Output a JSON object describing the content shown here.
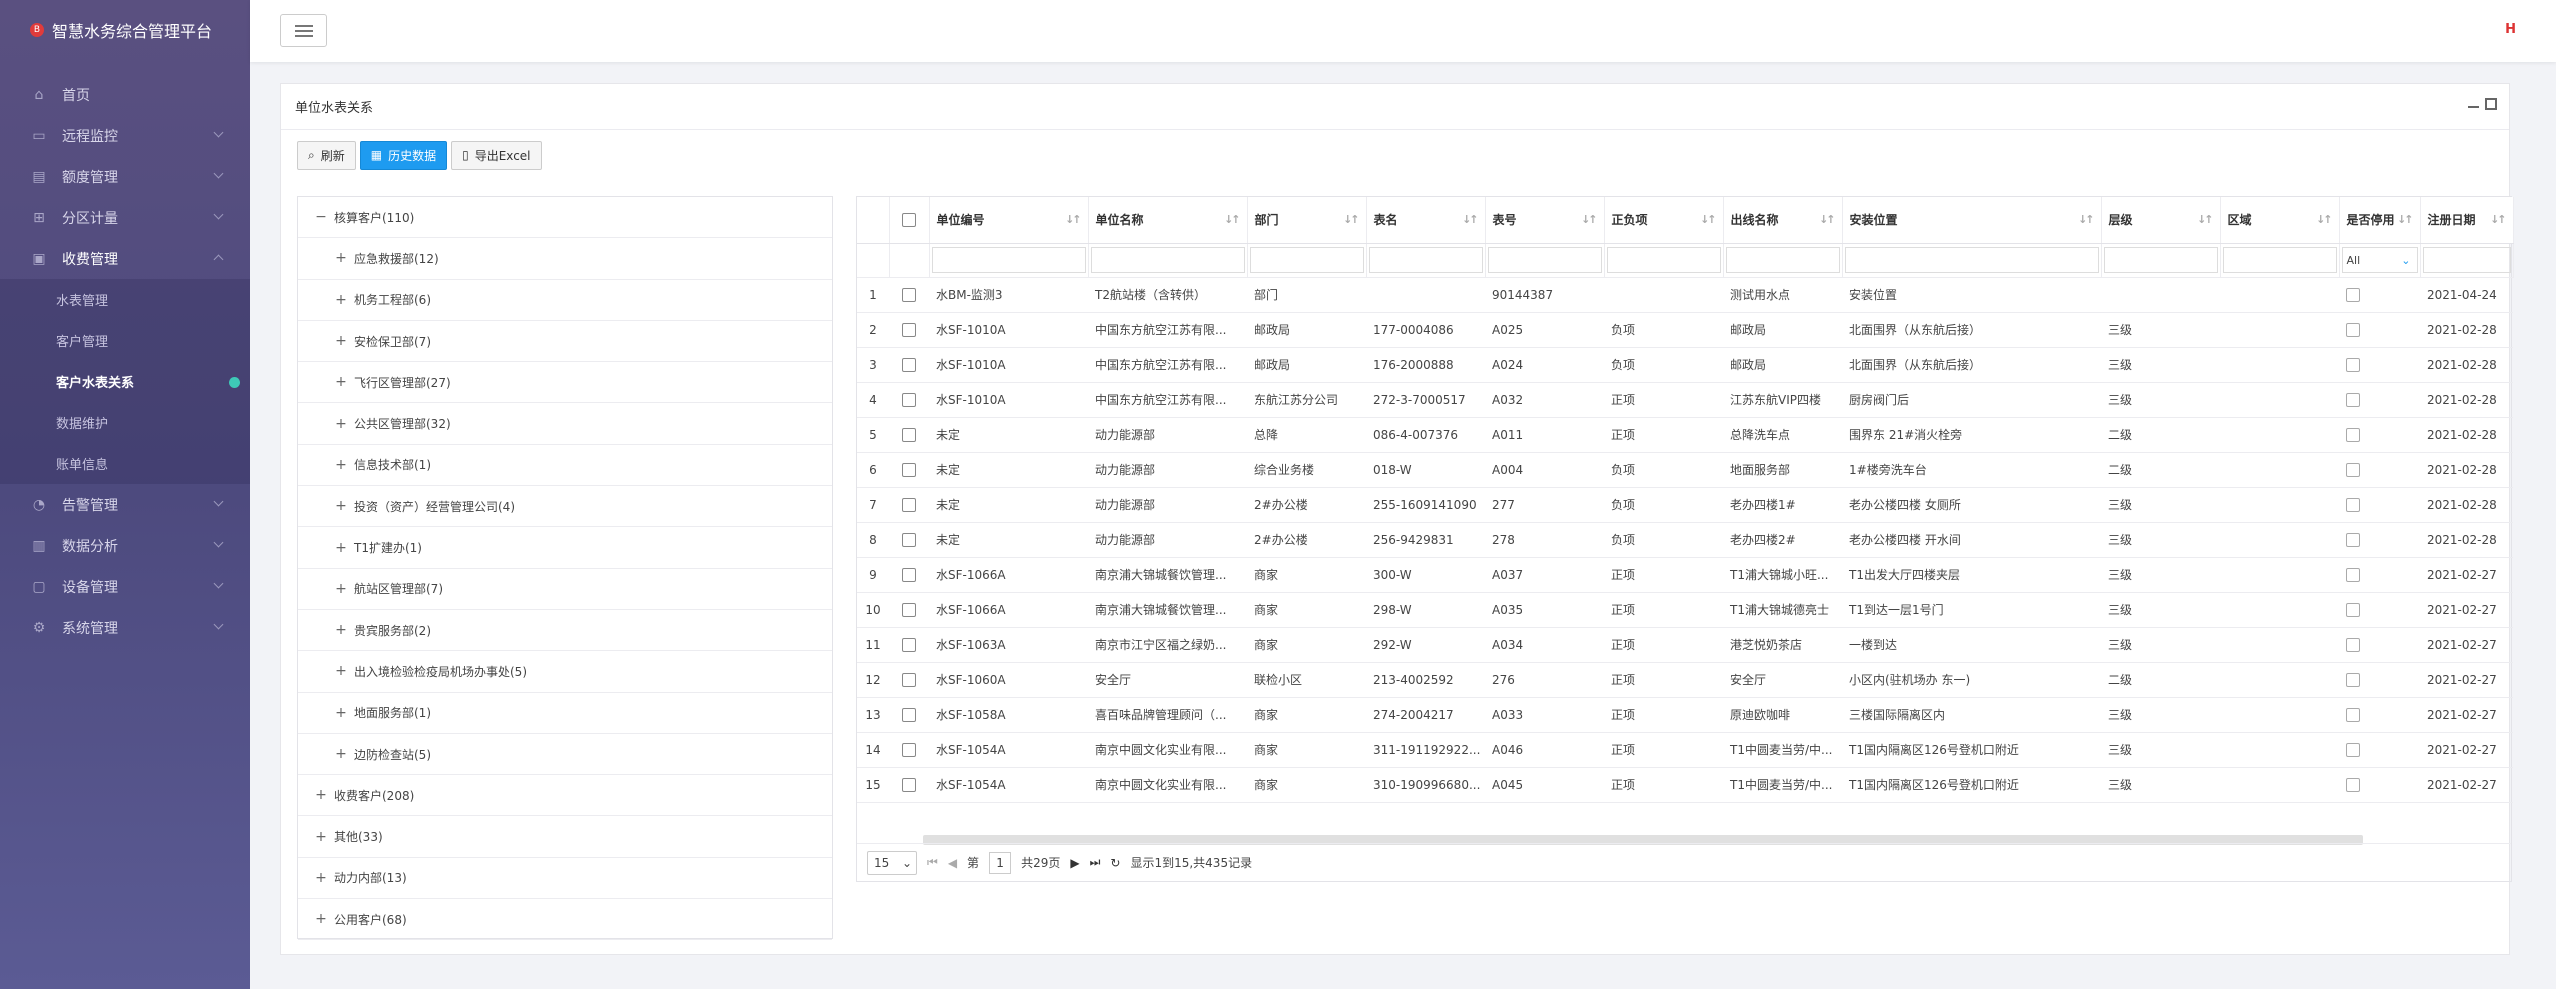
{
  "app": {
    "title": "智慧水务综合管理平台"
  },
  "sidebar": {
    "items": [
      {
        "label": "首页",
        "icon": "home-icon"
      },
      {
        "label": "远程监控",
        "icon": "monitor-icon"
      },
      {
        "label": "额度管理",
        "icon": "quota-icon"
      },
      {
        "label": "分区计量",
        "icon": "partition-icon"
      },
      {
        "label": "收费管理",
        "icon": "billing-icon"
      },
      {
        "label": "告警管理",
        "icon": "alarm-icon"
      },
      {
        "label": "数据分析",
        "icon": "analysis-icon"
      },
      {
        "label": "设备管理",
        "icon": "device-icon"
      },
      {
        "label": "系统管理",
        "icon": "settings-icon"
      }
    ],
    "sub_items": [
      "水表管理",
      "客户管理",
      "客户水表关系",
      "数据维护",
      "账单信息"
    ]
  },
  "panel": {
    "title": "单位水表关系"
  },
  "toolbar": {
    "refresh": "刷新",
    "history": "历史数据",
    "export": "导出Excel"
  },
  "tree": [
    {
      "label": "核算客户(110)",
      "sign": "−",
      "level": 0
    },
    {
      "label": "应急救援部(12)",
      "sign": "+",
      "level": 1
    },
    {
      "label": "机务工程部(6)",
      "sign": "+",
      "level": 1
    },
    {
      "label": "安检保卫部(7)",
      "sign": "+",
      "level": 1
    },
    {
      "label": "飞行区管理部(27)",
      "sign": "+",
      "level": 1
    },
    {
      "label": "公共区管理部(32)",
      "sign": "+",
      "level": 1
    },
    {
      "label": "信息技术部(1)",
      "sign": "+",
      "level": 1
    },
    {
      "label": "投资（资产）经营管理公司(4)",
      "sign": "+",
      "level": 1
    },
    {
      "label": "T1扩建办(1)",
      "sign": "+",
      "level": 1
    },
    {
      "label": "航站区管理部(7)",
      "sign": "+",
      "level": 1
    },
    {
      "label": "贵宾服务部(2)",
      "sign": "+",
      "level": 1
    },
    {
      "label": "出入境检验检疫局机场办事处(5)",
      "sign": "+",
      "level": 1
    },
    {
      "label": "地面服务部(1)",
      "sign": "+",
      "level": 1
    },
    {
      "label": "边防检查站(5)",
      "sign": "+",
      "level": 1
    },
    {
      "label": "收费客户(208)",
      "sign": "+",
      "level": 0
    },
    {
      "label": "其他(33)",
      "sign": "+",
      "level": 0
    },
    {
      "label": "动力内部(13)",
      "sign": "+",
      "level": 0
    },
    {
      "label": "公用客户(68)",
      "sign": "+",
      "level": 0
    }
  ],
  "grid": {
    "columns": [
      "单位编号",
      "单位名称",
      "部门",
      "表名",
      "表号",
      "正负项",
      "出线名称",
      "安装位置",
      "层级",
      "区域",
      "是否停用",
      "注册日期"
    ],
    "filter_placeholder_install": "安装位置",
    "filter_status": "All",
    "rows": [
      [
        "1",
        "水BM-监测3",
        "T2航站楼（含转供）",
        "部门",
        "",
        "90144387",
        "",
        "测试用水点",
        "安装位置",
        "",
        "",
        "2021-04-24"
      ],
      [
        "2",
        "水SF-1010A",
        "中国东方航空江苏有限...",
        "邮政局",
        "177-0004086",
        "A025",
        "负项",
        "邮政局",
        "北面围界（从东航后接）",
        "三级",
        "",
        "2021-02-28"
      ],
      [
        "3",
        "水SF-1010A",
        "中国东方航空江苏有限...",
        "邮政局",
        "176-2000888",
        "A024",
        "负项",
        "邮政局",
        "北面围界（从东航后接）",
        "三级",
        "",
        "2021-02-28"
      ],
      [
        "4",
        "水SF-1010A",
        "中国东方航空江苏有限...",
        "东航江苏分公司",
        "272-3-7000517",
        "A032",
        "正项",
        "江苏东航VIP四楼",
        "厨房阀门后",
        "三级",
        "",
        "2021-02-28"
      ],
      [
        "5",
        "未定",
        "动力能源部",
        "总降",
        "086-4-007376",
        "A011",
        "正项",
        "总降洗车点",
        "围界东 21#消火栓旁",
        "二级",
        "",
        "2021-02-28"
      ],
      [
        "6",
        "未定",
        "动力能源部",
        "综合业务楼",
        "018-W",
        "A004",
        "负项",
        "地面服务部",
        "1#楼旁洗车台",
        "二级",
        "",
        "2021-02-28"
      ],
      [
        "7",
        "未定",
        "动力能源部",
        "2#办公楼",
        "255-1609141090",
        "277",
        "负项",
        "老办四楼1#",
        "老办公楼四楼 女厕所",
        "三级",
        "",
        "2021-02-28"
      ],
      [
        "8",
        "未定",
        "动力能源部",
        "2#办公楼",
        "256-9429831",
        "278",
        "负项",
        "老办四楼2#",
        "老办公楼四楼 开水间",
        "三级",
        "",
        "2021-02-28"
      ],
      [
        "9",
        "水SF-1066A",
        "南京浦大锦城餐饮管理...",
        "商家",
        "300-W",
        "A037",
        "正项",
        "T1浦大锦城小旺...",
        "T1出发大厅四楼夹层",
        "三级",
        "",
        "2021-02-27"
      ],
      [
        "10",
        "水SF-1066A",
        "南京浦大锦城餐饮管理...",
        "商家",
        "298-W",
        "A035",
        "正项",
        "T1浦大锦城德亮士",
        "T1到达一层1号门",
        "三级",
        "",
        "2021-02-27"
      ],
      [
        "11",
        "水SF-1063A",
        "南京市江宁区福之绿奶...",
        "商家",
        "292-W",
        "A034",
        "正项",
        "港芝悦奶茶店",
        "一楼到达",
        "三级",
        "",
        "2021-02-27"
      ],
      [
        "12",
        "水SF-1060A",
        "安全厅",
        "联检小区",
        "213-4002592",
        "276",
        "正项",
        "安全厅",
        "小区内(驻机场办 东一)",
        "二级",
        "",
        "2021-02-27"
      ],
      [
        "13",
        "水SF-1058A",
        "喜百味品牌管理顾问（...",
        "商家",
        "274-2004217",
        "A033",
        "正项",
        "原迪欧咖啡",
        "三楼国际隔离区内",
        "三级",
        "",
        "2021-02-27"
      ],
      [
        "14",
        "水SF-1054A",
        "南京中圆文化实业有限...",
        "商家",
        "311-191192922...",
        "A046",
        "正项",
        "T1中圆麦当劳/中...",
        "T1国内隔离区126号登机口附近",
        "三级",
        "",
        "2021-02-27"
      ],
      [
        "15",
        "水SF-1054A",
        "南京中圆文化实业有限...",
        "商家",
        "310-190996680...",
        "A045",
        "正项",
        "T1中圆麦当劳/中...",
        "T1国内隔离区126号登机口附近",
        "三级",
        "",
        "2021-02-27"
      ]
    ]
  },
  "pager": {
    "page_size": "15",
    "prefix": "第",
    "current": "1",
    "total_pages": "共29页",
    "summary": "显示1到15,共435记录"
  },
  "colors": {
    "accent": "#1e9bf0",
    "sidebar": "#4d4a7e",
    "active_dot": "#3ec9b7"
  }
}
